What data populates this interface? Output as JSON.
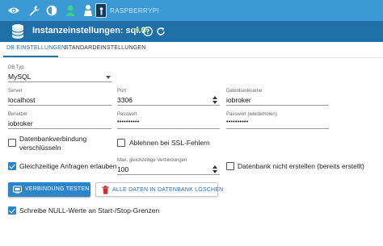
{
  "nav": {
    "brand": "RASPBERRYPI",
    "icons": [
      "eye-icon",
      "wrench-icon",
      "contrast-icon",
      "user-icon",
      "expert-mode-icon",
      "raspberry-logo-icon"
    ]
  },
  "header": {
    "title": "Instanzeinstellungen: sql.0",
    "version": "v3.2.0"
  },
  "tabs": [
    {
      "label": "DB EINSTELLUNGEN",
      "active": true
    },
    {
      "label": "STANDARDEINSTELLUNGEN",
      "active": false
    }
  ],
  "form": {
    "db_type": {
      "label": "DB Typ",
      "value": "MySQL"
    },
    "server": {
      "label": "Server",
      "value": "localhost"
    },
    "port": {
      "label": "Port",
      "value": "3306"
    },
    "dbname": {
      "label": "Datenbankname",
      "value": "iobroker"
    },
    "user": {
      "label": "Benutzer",
      "value": "iobroker"
    },
    "password": {
      "label": "Passwort",
      "value": "••••••••••"
    },
    "password_repeat": {
      "label": "Passwort (wiederholen)",
      "value": "••••••••••"
    },
    "encrypt": {
      "label": "Datenbankverbindung verschlüsseln",
      "checked": false
    },
    "reject_ssl": {
      "label": "Ablehnen bei SSL-Fehlern",
      "checked": false
    },
    "simultaneous": {
      "label": "Gleichzeitige Anfragen erlauben",
      "checked": true
    },
    "max_connections": {
      "label": "Max. gleichzeitige Verbindungen",
      "value": "100"
    },
    "no_create_db": {
      "label": "Datenbank nicht erstellen (bereits erstellt)",
      "checked": false
    },
    "null_values": {
      "label": "Schreibe NULL-Werte an Start-/Stop-Grenzen",
      "checked": true
    }
  },
  "buttons": {
    "test_connection": "VERBINDUNG TESTEN",
    "delete_all": "ALLE DATEN IN DATENBANK LÖSCHEN"
  },
  "colors": {
    "topnav": "#3b99d4",
    "titlebar": "#1f6fa8",
    "primary": "#2c84c9",
    "version": "#8fd44b",
    "delete": "#d32f2f"
  }
}
